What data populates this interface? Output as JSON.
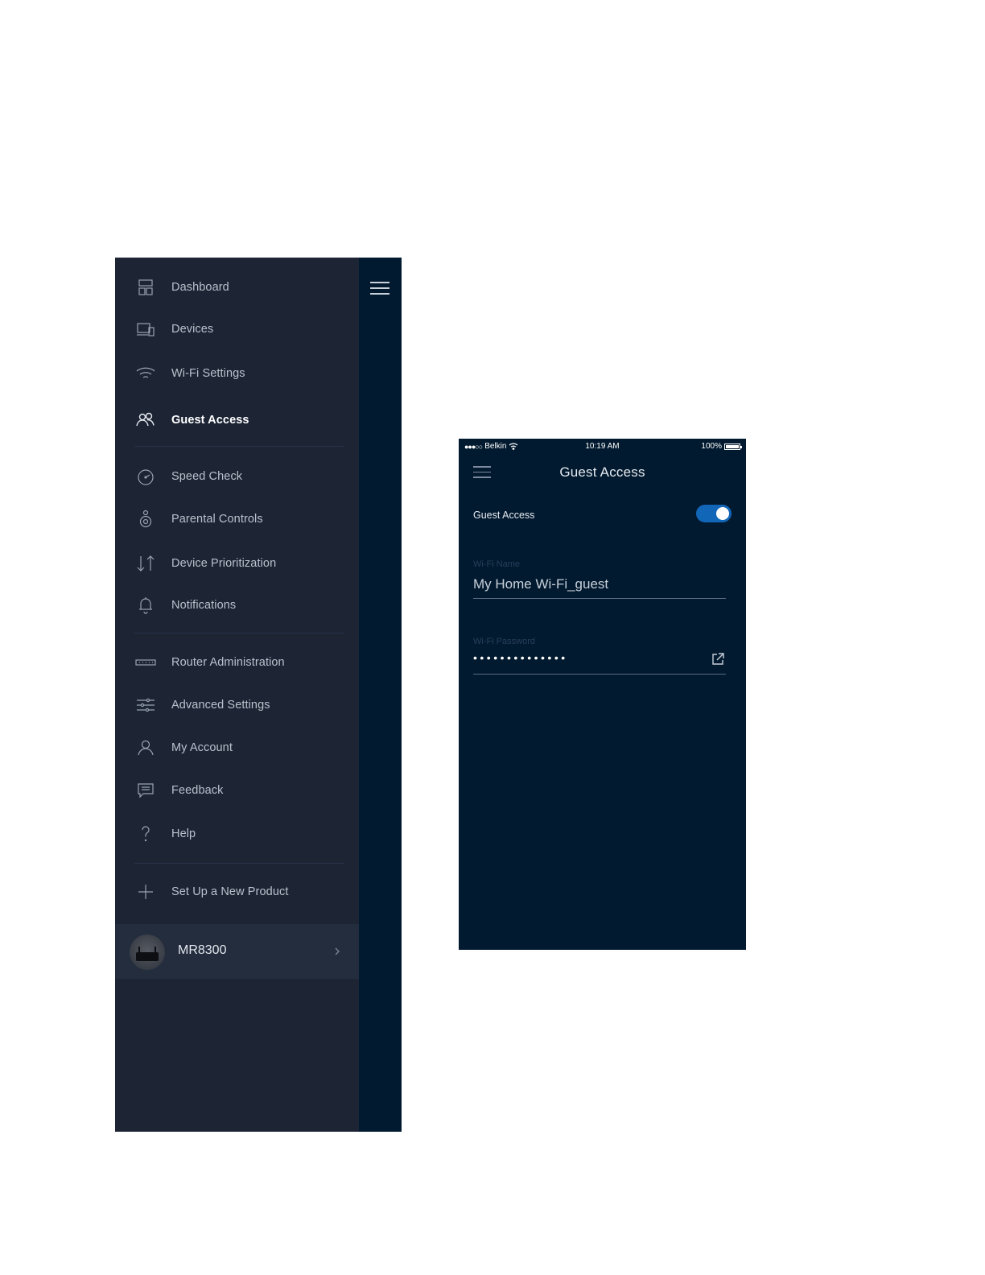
{
  "drawer": {
    "items": [
      {
        "label": "Dashboard",
        "icon": "dashboard-icon"
      },
      {
        "label": "Devices",
        "icon": "devices-icon"
      },
      {
        "label": "Wi-Fi Settings",
        "icon": "wifi-icon"
      },
      {
        "label": "Guest Access",
        "icon": "guest-access-icon",
        "active": true
      },
      {
        "label": "Speed Check",
        "icon": "speed-check-icon"
      },
      {
        "label": "Parental Controls",
        "icon": "parental-controls-icon"
      },
      {
        "label": "Device Prioritization",
        "icon": "prioritization-icon"
      },
      {
        "label": "Notifications",
        "icon": "bell-icon"
      },
      {
        "label": "Router Administration",
        "icon": "router-icon"
      },
      {
        "label": "Advanced Settings",
        "icon": "sliders-icon"
      },
      {
        "label": "My Account",
        "icon": "user-icon"
      },
      {
        "label": "Feedback",
        "icon": "feedback-icon"
      },
      {
        "label": "Help",
        "icon": "help-icon"
      },
      {
        "label": "Set Up a New Product",
        "icon": "plus-icon"
      }
    ],
    "router": {
      "name": "MR8300"
    }
  },
  "status_bar": {
    "carrier": "Belkin",
    "time": "10:19 AM",
    "battery": "100%"
  },
  "guest_screen": {
    "title": "Guest Access",
    "toggle_label": "Guest Access",
    "toggle_on": true,
    "wifi_name_label": "Wi-Fi Name",
    "wifi_name_value": "My Home Wi-Fi_guest",
    "wifi_password_label": "Wi-Fi Password",
    "wifi_password_masked": "••••••••••••••"
  },
  "colors": {
    "drawer_bg": "#1d2535",
    "screen_bg": "#021a2f",
    "toggle_on": "#1266b8"
  }
}
